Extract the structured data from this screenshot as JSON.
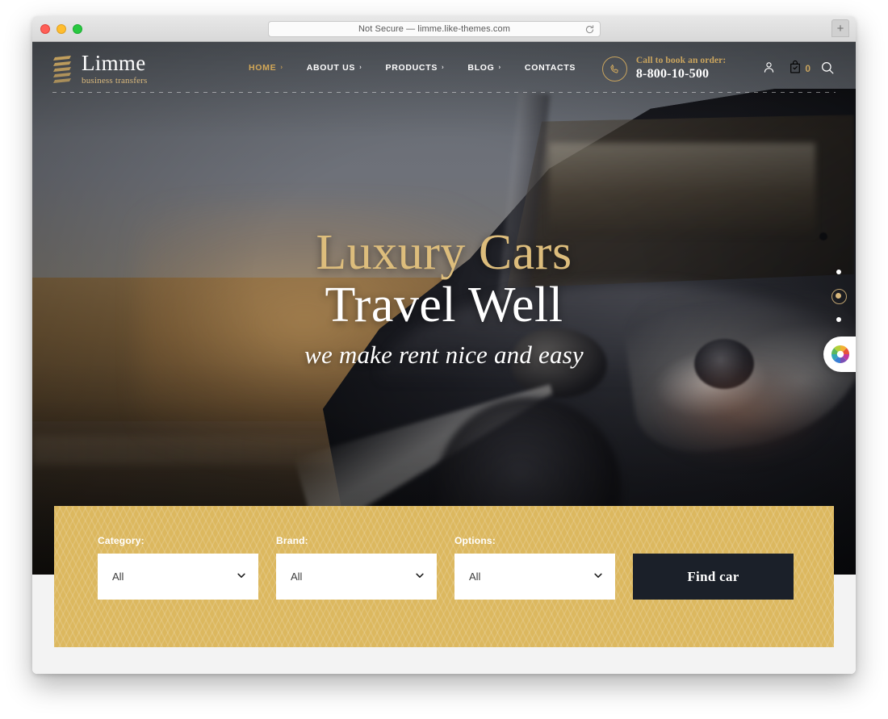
{
  "browser": {
    "url_text": "Not Secure — limme.like-themes.com",
    "reload_label": "",
    "newtab_label": "+",
    "traffic_lights": [
      "close",
      "minimize",
      "maximize"
    ]
  },
  "site": {
    "brand_name": "Limme",
    "brand_tagline": "business transfers",
    "nav": [
      {
        "label": "HOME",
        "has_caret": true,
        "active": true
      },
      {
        "label": "ABOUT US",
        "has_caret": true,
        "active": false
      },
      {
        "label": "PRODUCTS",
        "has_caret": true,
        "active": false
      },
      {
        "label": "BLOG",
        "has_caret": true,
        "active": false
      },
      {
        "label": "CONTACTS",
        "has_caret": false,
        "active": false
      }
    ],
    "caret_glyph": "›",
    "phone_label": "Call to book an order:",
    "phone_number": "8-800-10-500",
    "cart_count": "0"
  },
  "hero": {
    "line1": "Luxury Cars",
    "line2": "Travel Well",
    "subtitle": "we make rent nice and easy",
    "slides": 4,
    "active_slide": 2
  },
  "filter": {
    "fields": [
      {
        "label": "Category:",
        "value": "All"
      },
      {
        "label": "Brand:",
        "value": "All"
      },
      {
        "label": "Options:",
        "value": "All"
      }
    ],
    "caret_glyph": "⌄",
    "submit_label": "Find car"
  },
  "colors": {
    "gold": "#d3a857",
    "panel_gold": "#dcb85f",
    "hero_gold": "#ddbd7c",
    "dark": "#1b2029",
    "white": "#ffffff"
  }
}
